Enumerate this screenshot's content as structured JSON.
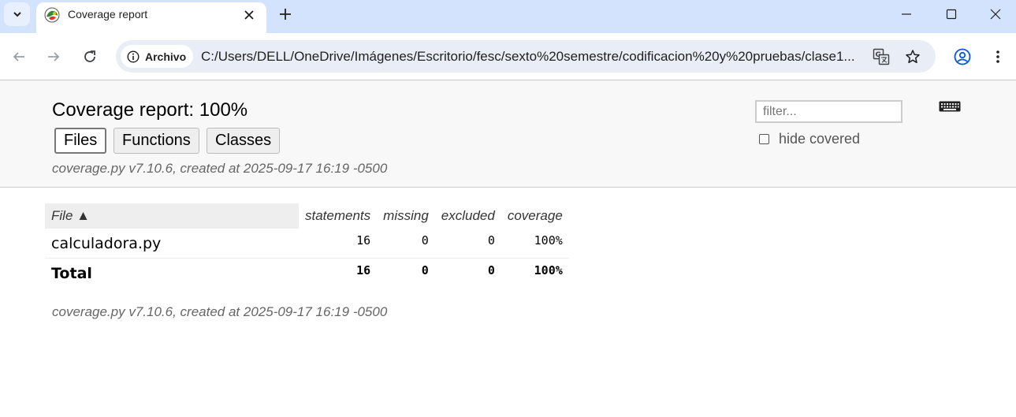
{
  "browser": {
    "tab_title": "Coverage report",
    "address_chip": "Archivo",
    "url": "C:/Users/DELL/OneDrive/Imágenes/Escritorio/fesc/sexto%20semestre/codificacion%20y%20pruebas/clase1..."
  },
  "header": {
    "title": "Coverage report: 100%",
    "nav": [
      "Files",
      "Functions",
      "Classes"
    ],
    "created": "coverage.py v7.10.6, created at 2025-09-17 16:19 -0500",
    "filter_placeholder": "filter...",
    "hide_covered_label": "hide covered"
  },
  "table": {
    "columns": [
      "File ▲",
      "statements",
      "missing",
      "excluded",
      "coverage"
    ],
    "rows": [
      {
        "file": "calculadora.py",
        "statements": "16",
        "missing": "0",
        "excluded": "0",
        "coverage": "100%"
      }
    ],
    "total": {
      "file": "Total",
      "statements": "16",
      "missing": "0",
      "excluded": "0",
      "coverage": "100%"
    }
  },
  "footer": {
    "created": "coverage.py v7.10.6, created at 2025-09-17 16:19 -0500"
  },
  "colors": {
    "tabstrip": "#d3e3fd",
    "omnibox": "#e9eef6",
    "header_bg": "#f8f8f8"
  }
}
